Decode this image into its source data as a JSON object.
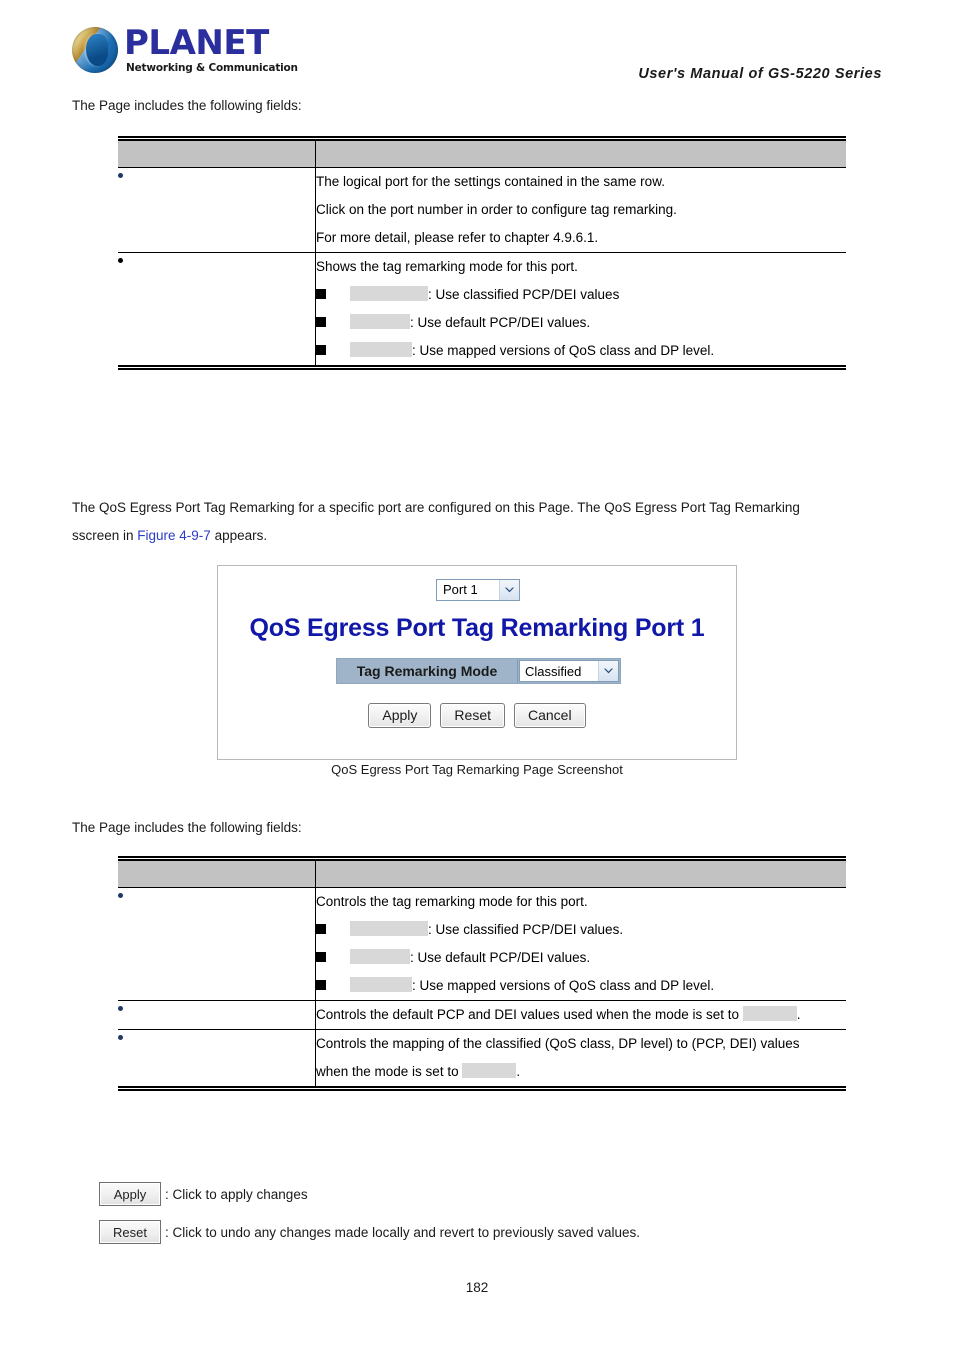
{
  "header": {
    "logo_wordmark": "PLANET",
    "logo_tagline": "Networking & Communication",
    "manual_title": "User's Manual of GS-5220 Series"
  },
  "intro_1": "The Page includes the following fields:",
  "table_1": {
    "head": {
      "col_label": "",
      "col_desc": ""
    },
    "rows": [
      {
        "label": "",
        "lines": [
          "The logical port for the settings contained in the same row.",
          "Click on the port number in order to configure tag remarking.",
          "For more detail, please refer to chapter 4.9.6.1."
        ],
        "bullets": []
      },
      {
        "label": "",
        "lines": [
          "Shows the tag remarking mode for this port."
        ],
        "bullets": [
          {
            "term": "",
            "text": ": Use classified PCP/DEI values"
          },
          {
            "term": "",
            "text": ": Use default PCP/DEI values."
          },
          {
            "term": "",
            "text": ": Use mapped versions of QoS class and DP level."
          }
        ]
      }
    ]
  },
  "body_para": {
    "line1": "The QoS Egress Port Tag Remarking for a specific port are configured on this Page. The QoS Egress Port Tag Remarking",
    "line2_pre": "sscreen in ",
    "line2_link": "Figure 4-9-7",
    "line2_post": " appears."
  },
  "figure": {
    "port_select_value": "Port 1",
    "title": "QoS Egress Port Tag Remarking  Port 1",
    "form_label": "Tag Remarking Mode",
    "form_value": "Classified",
    "buttons": [
      "Apply",
      "Reset",
      "Cancel"
    ],
    "caption": "QoS Egress Port Tag Remarking Page Screenshot"
  },
  "intro_2": "The Page includes the following fields:",
  "table_2": {
    "head": {
      "col_label": "",
      "col_desc": ""
    },
    "rows": [
      {
        "label": "",
        "lines": [
          "Controls the tag remarking mode for this port."
        ],
        "bullets": [
          {
            "term": "",
            "text": ": Use classified PCP/DEI values."
          },
          {
            "term": "",
            "text": ": Use default PCP/DEI values."
          },
          {
            "term": "",
            "text": ": Use mapped versions of QoS class and DP level."
          }
        ]
      },
      {
        "label": "",
        "lines_mixed": {
          "pre": "Controls the default PCP and DEI values used when the mode is set to ",
          "redact": "",
          "post": "."
        },
        "bullets": []
      },
      {
        "label": "",
        "lines_mixed2": {
          "line1": "Controls the mapping of the classified (QoS class, DP level) to (PCP, DEI) values",
          "pre": "when the mode is set to ",
          "redact": "",
          "post": "."
        },
        "bullets": []
      }
    ]
  },
  "legend": [
    {
      "button": "Apply",
      "text": ": Click to apply changes"
    },
    {
      "button": "Reset",
      "text": ": Click to undo any changes made locally and revert to previously saved values."
    }
  ],
  "page_number": "182",
  "colors": {
    "table_header_gray": "#c2c2c2",
    "redaction_gray": "#d8d8d8",
    "link_blue": "#2b3cc8",
    "figure_title_blue": "#1118a8",
    "brand_blue": "#2b2f9e"
  }
}
